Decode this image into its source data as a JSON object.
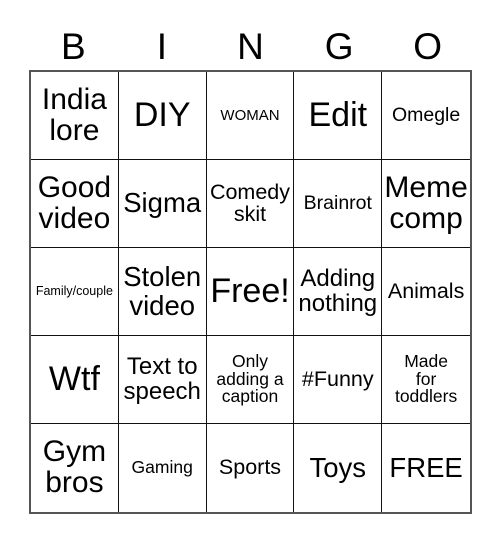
{
  "header": {
    "letters": [
      "B",
      "I",
      "N",
      "G",
      "O"
    ]
  },
  "grid": {
    "columns": 5,
    "rows": 5,
    "cells": [
      [
        {
          "text": "India\nlore",
          "size": "fs-xxl"
        },
        {
          "text": "DIY",
          "size": "fs-huge"
        },
        {
          "text": "WOMAN",
          "size": "fs-sm"
        },
        {
          "text": "Edit",
          "size": "fs-huge"
        },
        {
          "text": "Omegle",
          "size": "fs-md"
        }
      ],
      [
        {
          "text": "Good\nvideo",
          "size": "fs-xxl"
        },
        {
          "text": "Sigma",
          "size": "fs-xl"
        },
        {
          "text": "Comedy\nskit",
          "size": "fs-mdl"
        },
        {
          "text": "Brainrot",
          "size": "fs-md"
        },
        {
          "text": "Meme\ncomp",
          "size": "fs-xxl"
        }
      ],
      [
        {
          "text": "Family/couple",
          "size": "fs-xs"
        },
        {
          "text": "Stolen\nvideo",
          "size": "fs-xl"
        },
        {
          "text": "Free!",
          "size": "fs-huge"
        },
        {
          "text": "Adding\nnothing",
          "size": "fs-lg"
        },
        {
          "text": "Animals",
          "size": "fs-mdl"
        }
      ],
      [
        {
          "text": "Wtf",
          "size": "fs-huge"
        },
        {
          "text": "Text to\nspeech",
          "size": "fs-lg"
        },
        {
          "text": "Only\nadding a\ncaption",
          "size": "fs-smd"
        },
        {
          "text": "#Funny",
          "size": "fs-mdl"
        },
        {
          "text": "Made\nfor\ntoddlers",
          "size": "fs-smd"
        }
      ],
      [
        {
          "text": "Gym\nbros",
          "size": "fs-xxl"
        },
        {
          "text": "Gaming",
          "size": "fs-smd"
        },
        {
          "text": "Sports",
          "size": "fs-mdl"
        },
        {
          "text": "Toys",
          "size": "fs-xl"
        },
        {
          "text": "FREE",
          "size": "fs-xl"
        }
      ]
    ]
  },
  "colors": {
    "background": "#ffffff",
    "text": "#000000",
    "grid_line": "#111111",
    "grid_outline": "#555555"
  }
}
